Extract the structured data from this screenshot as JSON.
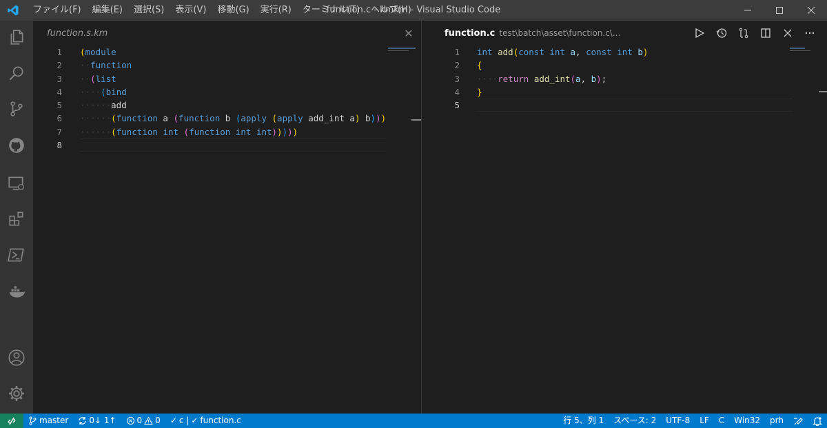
{
  "window": {
    "title": "function.c - kmkm - Visual Studio Code",
    "menu": [
      "ファイル(F)",
      "編集(E)",
      "選択(S)",
      "表示(V)",
      "移動(G)",
      "実行(R)",
      "ターミナル(T)",
      "ヘルプ(H)"
    ]
  },
  "activity_bar": [
    "explorer-icon",
    "search-icon",
    "source-control-icon",
    "github-icon",
    "remote-explorer-icon",
    "extensions-icon",
    "powershell-icon",
    "docker-icon",
    "account-icon",
    "settings-gear-icon"
  ],
  "left_editor": {
    "tab": "function.s.km",
    "active_line": 8,
    "lines": [
      {
        "n": "1",
        "t": [
          [
            "(",
            "b1"
          ],
          [
            "module",
            "k-kw"
          ]
        ]
      },
      {
        "n": "2",
        "t": [
          [
            "··",
            "guide"
          ],
          [
            "function",
            "k-kw"
          ]
        ]
      },
      {
        "n": "3",
        "t": [
          [
            "··",
            "guide"
          ],
          [
            "(",
            "b2"
          ],
          [
            "list",
            "k-kw"
          ]
        ]
      },
      {
        "n": "4",
        "t": [
          [
            "····",
            "guide"
          ],
          [
            "(",
            "b3"
          ],
          [
            "bind",
            "k-kw"
          ]
        ]
      },
      {
        "n": "5",
        "t": [
          [
            "······",
            "guide"
          ],
          [
            "add",
            "k-def"
          ]
        ]
      },
      {
        "n": "6",
        "t": [
          [
            "······",
            "guide"
          ],
          [
            "(",
            "b1"
          ],
          [
            "function",
            "k-kw"
          ],
          [
            " a ",
            "k-def"
          ],
          [
            "(",
            "b2"
          ],
          [
            "function",
            "k-kw"
          ],
          [
            " b ",
            "k-def"
          ],
          [
            "(",
            "b3"
          ],
          [
            "apply",
            "k-kw"
          ],
          [
            " ",
            "k-def"
          ],
          [
            "(",
            "b1"
          ],
          [
            "apply",
            "k-kw"
          ],
          [
            " add_int a",
            "k-def"
          ],
          [
            ")",
            "b1"
          ],
          [
            " b",
            "k-def"
          ],
          [
            ")",
            "b3"
          ],
          [
            ")",
            "b2"
          ],
          [
            ")",
            "b1"
          ]
        ]
      },
      {
        "n": "7",
        "t": [
          [
            "······",
            "guide"
          ],
          [
            "(",
            "b1"
          ],
          [
            "function",
            "k-kw"
          ],
          [
            " ",
            "k-def"
          ],
          [
            "int",
            "k-kw"
          ],
          [
            " ",
            "k-def"
          ],
          [
            "(",
            "b2"
          ],
          [
            "function",
            "k-kw"
          ],
          [
            " ",
            "k-def"
          ],
          [
            "int",
            "k-kw"
          ],
          [
            " ",
            "k-def"
          ],
          [
            "int",
            "k-kw"
          ],
          [
            ")",
            "b2"
          ],
          [
            ")",
            "b1"
          ],
          [
            ")",
            "b3"
          ],
          [
            ")",
            "b2"
          ],
          [
            ")",
            "b1"
          ]
        ]
      },
      {
        "n": "8",
        "t": []
      }
    ]
  },
  "right_editor": {
    "tab": "function.c",
    "path": "test\\batch\\asset\\function.c\\...",
    "active_line": 5,
    "lines": [
      {
        "n": "1",
        "t": [
          [
            "int",
            "k-kw"
          ],
          [
            " ",
            "k-def"
          ],
          [
            "add",
            "k-fn"
          ],
          [
            "(",
            "b1"
          ],
          [
            "const",
            "k-kw"
          ],
          [
            " ",
            "k-def"
          ],
          [
            "int",
            "k-kw"
          ],
          [
            " ",
            "k-def"
          ],
          [
            "a",
            "k-id"
          ],
          [
            ", ",
            "k-def"
          ],
          [
            "const",
            "k-kw"
          ],
          [
            " ",
            "k-def"
          ],
          [
            "int",
            "k-kw"
          ],
          [
            " ",
            "k-def"
          ],
          [
            "b",
            "k-id"
          ],
          [
            ")",
            "b1"
          ]
        ]
      },
      {
        "n": "2",
        "t": [
          [
            "{",
            "b1"
          ]
        ]
      },
      {
        "n": "3",
        "t": [
          [
            "··",
            "guide"
          ],
          [
            "··",
            "guide"
          ],
          [
            "return",
            "k-ctl"
          ],
          [
            " ",
            "k-def"
          ],
          [
            "add_int",
            "k-fn"
          ],
          [
            "(",
            "b2"
          ],
          [
            "a",
            "k-id"
          ],
          [
            ", ",
            "k-def"
          ],
          [
            "b",
            "k-id"
          ],
          [
            ")",
            "b2"
          ],
          [
            ";",
            "k-def"
          ]
        ]
      },
      {
        "n": "4",
        "t": [
          [
            "}",
            "b1"
          ]
        ]
      },
      {
        "n": "5",
        "t": []
      }
    ]
  },
  "statusbar": {
    "branch": "master",
    "sync": "0↓ 1↑",
    "errors": "0",
    "warnings": "0",
    "lang_check": "c |",
    "file_check": "function.c",
    "position": "行 5、列 1",
    "indent": "スペース: 2",
    "encoding": "UTF-8",
    "eol": "LF",
    "language": "C",
    "platform": "Win32",
    "user": "prh"
  }
}
